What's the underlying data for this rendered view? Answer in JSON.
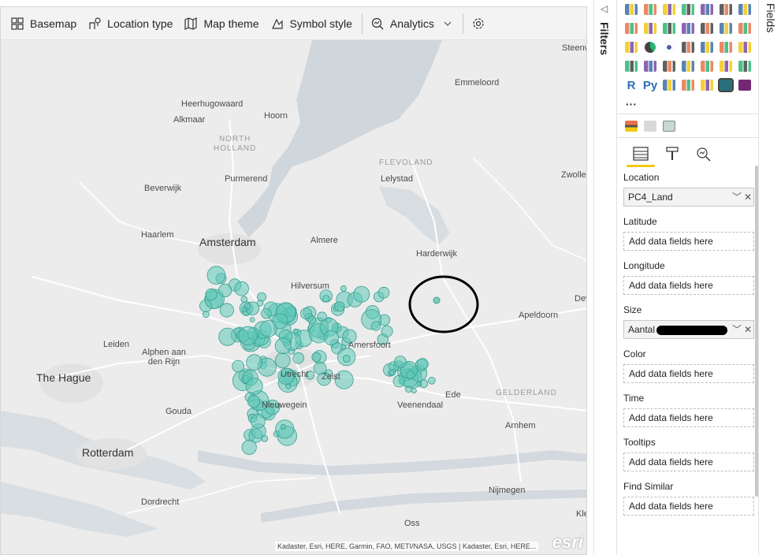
{
  "toolbar": {
    "basemap": "Basemap",
    "location_type": "Location type",
    "map_theme": "Map theme",
    "symbol_style": "Symbol style",
    "analytics": "Analytics"
  },
  "map": {
    "places": [
      {
        "name": "Steenw",
        "kind": "place"
      },
      {
        "name": "Emmeloord",
        "kind": "place"
      },
      {
        "name": "Heerhugowaard",
        "kind": "place"
      },
      {
        "name": "Alkmaar",
        "kind": "place"
      },
      {
        "name": "Hoorn",
        "kind": "place"
      },
      {
        "name": "Lelystad",
        "kind": "place"
      },
      {
        "name": "Zwolle",
        "kind": "place"
      },
      {
        "name": "Purmerend",
        "kind": "place"
      },
      {
        "name": "Beverwijk",
        "kind": "place"
      },
      {
        "name": "Haarlem",
        "kind": "place"
      },
      {
        "name": "Amsterdam",
        "kind": "city"
      },
      {
        "name": "Almere",
        "kind": "place"
      },
      {
        "name": "Harderwijk",
        "kind": "place"
      },
      {
        "name": "Hilversum",
        "kind": "place"
      },
      {
        "name": "Dev",
        "kind": "place"
      },
      {
        "name": "Apeldoorn",
        "kind": "place"
      },
      {
        "name": "Leiden",
        "kind": "place"
      },
      {
        "name": "Alphen aan den Rijn",
        "kind": "place"
      },
      {
        "name": "Amersfoort",
        "kind": "place"
      },
      {
        "name": "The Hague",
        "kind": "city"
      },
      {
        "name": "Utrecht",
        "kind": "place"
      },
      {
        "name": "Zeist",
        "kind": "place"
      },
      {
        "name": "Ede",
        "kind": "place"
      },
      {
        "name": "Gouda",
        "kind": "place"
      },
      {
        "name": "Nieuwegein",
        "kind": "place"
      },
      {
        "name": "Veenendaal",
        "kind": "place"
      },
      {
        "name": "Arnhem",
        "kind": "place"
      },
      {
        "name": "Rotterdam",
        "kind": "city"
      },
      {
        "name": "Nijmegen",
        "kind": "place"
      },
      {
        "name": "Dordrecht",
        "kind": "place"
      },
      {
        "name": "Oss",
        "kind": "place"
      },
      {
        "name": "Kle",
        "kind": "place"
      }
    ],
    "regions": [
      "NORTH HOLLAND",
      "FLEVOLAND",
      "GELDERLAND"
    ],
    "bubble_color": "#5ec8b8",
    "highlight_color": "#000000",
    "attribution": "Kadaster, Esri, HERE, Garmin, FAO, METI/NASA, USGS | Kadaster, Esri, HERE...",
    "logo": "esri"
  },
  "filters": {
    "title": "Filters"
  },
  "fields_pane": {
    "title": "Fields"
  },
  "visualizations": {
    "gallery": [
      "stacked-bar-icon",
      "stacked-column-icon",
      "clustered-bar-icon",
      "clustered-column-icon",
      "100-stacked-bar-icon",
      "100-stacked-column-icon",
      "line-chart-icon",
      "area-chart-icon",
      "stacked-area-icon",
      "line-column-icon",
      "line-clustered-column-icon",
      "ribbon-chart-icon",
      "waterfall-icon",
      "funnel-icon",
      "scatter-icon",
      "pie-icon",
      "donut-icon",
      "treemap-icon",
      "map-icon",
      "filled-map-icon",
      "shape-map-icon",
      "gauge-icon",
      "card-icon",
      "multirow-card-icon",
      "kpi-icon",
      "slicer-icon",
      "table-icon",
      "matrix-icon",
      "r-visual-icon",
      "python-visual-icon",
      "key-influencers-icon",
      "decomposition-tree-icon",
      "qa-icon",
      "arcgis-map-icon",
      "power-apps-icon",
      "more-icon"
    ],
    "gallery_glyphs": {
      "r": "R",
      "py": "Py",
      "more": "···"
    },
    "tabs": [
      "fields-tab",
      "format-tab",
      "analytics-tab"
    ],
    "wells": {
      "location": {
        "label": "Location",
        "field": "PC4_Land"
      },
      "latitude": {
        "label": "Latitude",
        "placeholder": "Add data fields here"
      },
      "longitude": {
        "label": "Longitude",
        "placeholder": "Add data fields here"
      },
      "size": {
        "label": "Size",
        "field": "Aantal"
      },
      "color": {
        "label": "Color",
        "placeholder": "Add data fields here"
      },
      "time": {
        "label": "Time",
        "placeholder": "Add data fields here"
      },
      "tooltips": {
        "label": "Tooltips",
        "placeholder": "Add data fields here"
      },
      "find_similar": {
        "label": "Find Similar",
        "placeholder": "Add data fields here"
      }
    }
  }
}
